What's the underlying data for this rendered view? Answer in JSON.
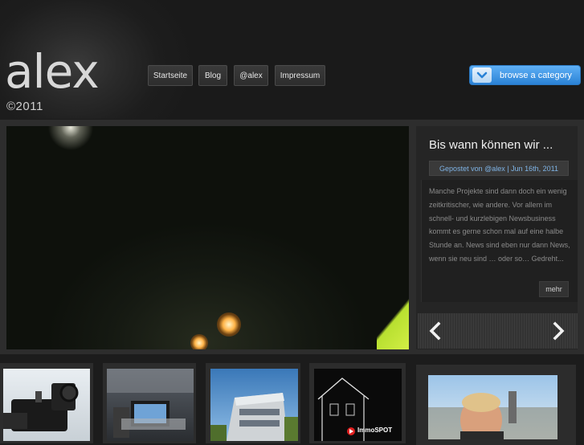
{
  "logo": {
    "text": "alex",
    "year": "©2011"
  },
  "nav": {
    "items": [
      {
        "label": "Startseite"
      },
      {
        "label": "Blog"
      },
      {
        "label": "@alex"
      },
      {
        "label": "Impressum"
      }
    ],
    "browse_label": "browse a category"
  },
  "featured_post": {
    "title": "Bis wann können wir ...",
    "meta": "Gepostet von @alex | Jun 16th, 2011",
    "excerpt": "Manche Projekte sind dann doch ein wenig zeitkritischer, wie andere. Vor allem im schnell- und kurzlebigen Newsbusiness kommt es gerne schon mal auf eine halbe Stunde an. News sind eben nur dann News, wenn sie neu sind … oder so… Gedreht...",
    "more_label": "mehr"
  },
  "thumbnails": {
    "immospot_logo_text": "ImmoSPOT"
  },
  "colors": {
    "accent_blue": "#3a8fe0",
    "meta_link": "#7fb4e6",
    "background": "#1c1c1c"
  }
}
